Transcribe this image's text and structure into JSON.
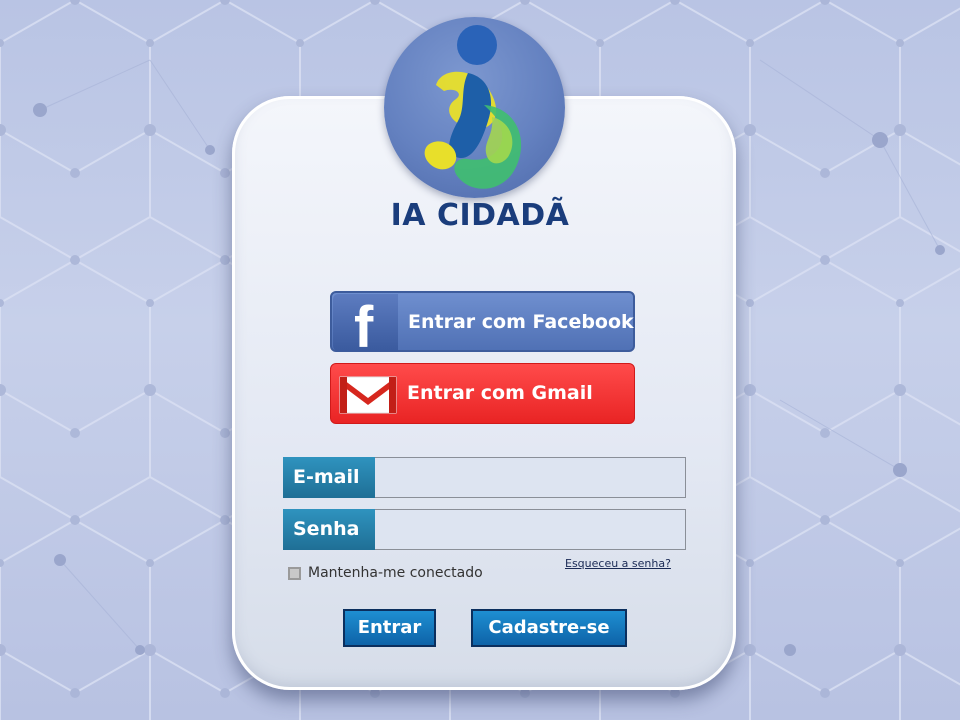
{
  "brand": {
    "name": "IA CIDADÃ",
    "logo_icon": "person-swirl-logo-icon",
    "colors": {
      "navy": "#1a3d7c",
      "yellow": "#e8df2a",
      "green": "#3fbf6f",
      "blue": "#1e5fa8"
    }
  },
  "social_login": {
    "facebook": {
      "label": "Entrar com Facebook",
      "icon": "facebook-icon",
      "color": "#5071b5"
    },
    "gmail": {
      "label": "Entrar com Gmail",
      "icon": "gmail-envelope-icon",
      "color": "#e92424"
    }
  },
  "form": {
    "email": {
      "label": "E-mail",
      "value": "",
      "placeholder": ""
    },
    "password": {
      "label": "Senha",
      "value": "",
      "placeholder": ""
    },
    "remember_me": {
      "label": "Mantenha-me conectado",
      "checked": false
    },
    "forgot_password": "Esqueceu a senha?"
  },
  "actions": {
    "login_label": "Entrar",
    "signup_label": "Cadastre-se",
    "button_color": "#0e63a8"
  },
  "background": {
    "pattern": "hexagon-network",
    "color": "#c0c9e6"
  }
}
